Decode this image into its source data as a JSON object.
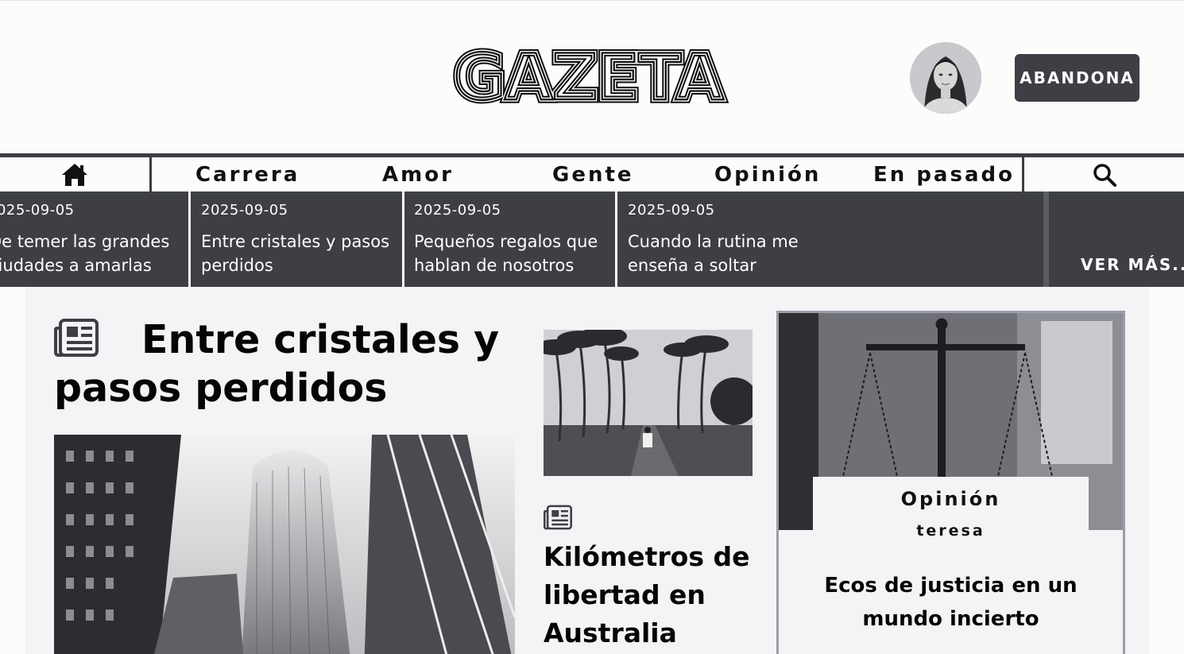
{
  "header": {
    "logo_text": "GAZETA",
    "leave_label": "ABANDONA",
    "avatar_icon": "user-avatar"
  },
  "nav": {
    "home_icon": "home-icon",
    "items": [
      "Carrera",
      "Amor",
      "Gente",
      "Opinión",
      "En pasado"
    ],
    "search_icon": "search-icon"
  },
  "ticker": {
    "items": [
      {
        "date": "2025-09-05",
        "title_line1": "De temer las grandes",
        "title_line2": "ciudades a amarlas"
      },
      {
        "date": "2025-09-05",
        "title_line1": "Entre cristales y pasos",
        "title_line2": "perdidos"
      },
      {
        "date": "2025-09-05",
        "title_line1": "Pequeños regalos que",
        "title_line2": "hablan de nosotros"
      },
      {
        "date": "2025-09-05",
        "title_line1": "Cuando la rutina me",
        "title_line2": "enseña a soltar"
      }
    ],
    "more_label": "VER MÁS..."
  },
  "lead": {
    "icon": "newspaper-icon",
    "title": "Entre cristales y pasos perdidos"
  },
  "secondary": {
    "icon": "newspaper-icon",
    "title": "Kilómetros de libertad en Australia"
  },
  "opinion_card": {
    "category": "Opinión",
    "author": "teresa",
    "title": "Ecos de justicia en un mundo incierto"
  },
  "colors": {
    "dark": "#3d3f45",
    "background": "#fdfcfb",
    "content_bg": "#f4f3f5",
    "card_border": "#9c9daa"
  }
}
